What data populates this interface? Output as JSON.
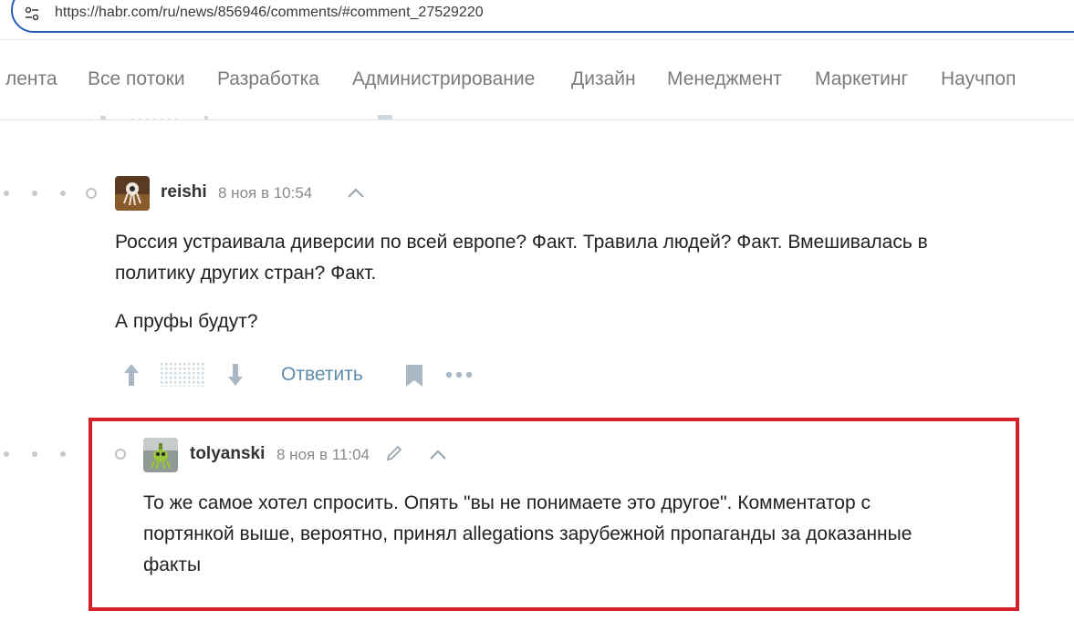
{
  "browser": {
    "url": "https://habr.com/ru/news/856946/comments/#comment_27529220",
    "site_icon": "tune-icon"
  },
  "nav": {
    "items": [
      "лента",
      "Все потоки",
      "Разработка",
      "Администрирование",
      "Дизайн",
      "Менеджмент",
      "Маркетинг",
      "Научпоп"
    ]
  },
  "comments": [
    {
      "author": "reishi",
      "time": "8 ноя в 10:54",
      "paragraphs": [
        "Россия устраивала диверсии по всей европе? Факт. Травила людей? Факт. Вмешивалась в",
        "политику других стран? Факт.",
        "А пруфы будут?"
      ],
      "actions": {
        "reply_label": "Ответить",
        "upvote_icon": "arrow-up-icon",
        "downvote_icon": "arrow-down-icon",
        "bookmark_icon": "bookmark-icon",
        "more_icon": "more-icon"
      }
    },
    {
      "author": "tolyanski",
      "time": "8 ноя в 11:04",
      "edited_icon": "pencil-icon",
      "paragraphs": [
        "То же самое хотел спросить. Опять \"вы не понимаете это другое\". Комментатор с",
        "портянкой выше, вероятно, принял allegations зарубежной пропаганды за доказанные",
        "факты"
      ]
    }
  ],
  "colors": {
    "accent_link": "#5e8cad",
    "highlight_border": "#d2232a",
    "url_border": "#2a5db8"
  }
}
